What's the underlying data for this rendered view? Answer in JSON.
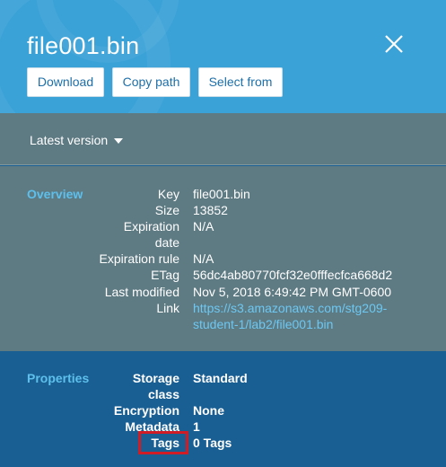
{
  "header": {
    "title": "file001.bin",
    "buttons": {
      "download": "Download",
      "copy_path": "Copy path",
      "select_from": "Select from"
    }
  },
  "version": {
    "selected": "Latest version"
  },
  "overview": {
    "section_title": "Overview",
    "key_label": "Key",
    "key_value": "file001.bin",
    "size_label": "Size",
    "size_value": "13852",
    "expiration_date_label_1": "Expiration",
    "expiration_date_label_2": "date",
    "expiration_date_value": "N/A",
    "expiration_rule_label": "Expiration rule",
    "expiration_rule_value": "N/A",
    "etag_label": "ETag",
    "etag_value": "56dc4ab80770fcf32e0fffecfca668d2",
    "last_modified_label": "Last modified",
    "last_modified_value": "Nov 5, 2018 6:49:42 PM GMT-0600",
    "link_label": "Link",
    "link_line_1": "https://s3.amazonaws.com/stg209-",
    "link_line_2": "student-1/lab2/file001.bin"
  },
  "properties": {
    "section_title": "Properties",
    "storage_class_label_1": "Storage",
    "storage_class_label_2": "class",
    "storage_class_value": "Standard",
    "encryption_label": "Encryption",
    "encryption_value": "None",
    "metadata_label": "Metadata",
    "metadata_value": "1",
    "tags_label": "Tags",
    "tags_value": "0 Tags"
  },
  "colors": {
    "header_bg": "#3aa2d7",
    "panel_bg": "#5e7a83",
    "properties_bg": "#1a5f93",
    "accent": "#5dc0ec",
    "highlight": "#d01c24"
  }
}
